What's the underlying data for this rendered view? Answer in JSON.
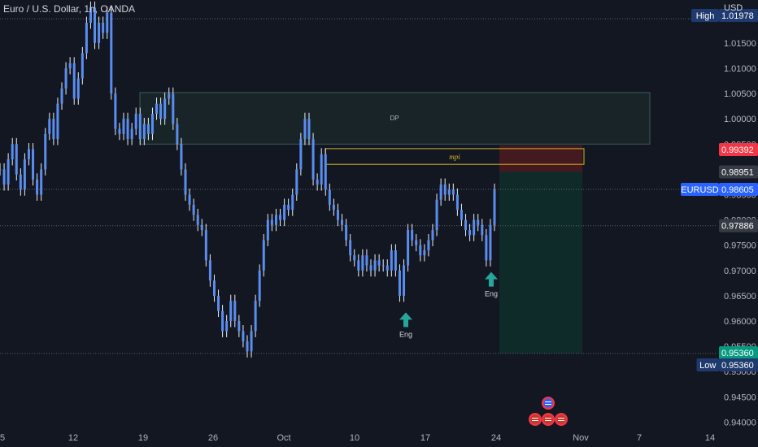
{
  "header": {
    "title": "Euro / U.S. Dollar, 1h, OANDA",
    "currency": "USD"
  },
  "colors": {
    "background": "#131722",
    "candle": "#5b8def",
    "candle_wick": "#e8eefc",
    "dp_zone_fill": "#1b2a2a",
    "mpi_box": "#d4b422",
    "stop_zone": "#4a1a1f",
    "target_zone": "#0f2e2a",
    "arrow": "#26a69a",
    "high_tag": "#1f3a6e",
    "current_tag": "#2962ff",
    "stop_tag": "#f23645",
    "neutral_tag": "#363a45",
    "low_target_tag": "#089981"
  },
  "chart_data": {
    "type": "line",
    "title": "Euro / U.S. Dollar, 1h, OANDA",
    "symbol": "EURUSD",
    "xlabel": "",
    "ylabel": "USD",
    "ylim": [
      0.9375,
      1.0235
    ],
    "grid": false,
    "x_ticks": [
      "5",
      "12",
      "19",
      "26",
      "Oct",
      "10",
      "17",
      "24",
      "Nov",
      "7",
      "14"
    ],
    "y_ticks": [
      "1.01500",
      "1.01000",
      "1.00500",
      "1.00000",
      "0.99500",
      "0.98500",
      "0.98000",
      "0.97500",
      "0.97000",
      "0.96500",
      "0.96000",
      "0.95500",
      "0.95000",
      "0.94500",
      "0.94000"
    ],
    "series": [
      {
        "values": [
          0.99,
          0.987,
          0.992,
          0.995,
          0.989,
          0.986,
          0.992,
          0.994,
          0.988,
          0.985,
          0.99,
          0.997,
          1.0,
          0.996,
          1.003,
          1.006,
          1.01,
          1.011,
          1.004,
          1.008,
          1.013,
          1.019,
          1.022,
          1.015,
          1.019,
          1.017,
          1.021,
          1.005,
          0.998,
          0.997,
          1.0,
          0.996,
          0.998,
          1.001,
          0.996,
          0.999,
          0.997,
          1.001,
          1.003,
          1.0,
          1.004,
          1.005,
          0.999,
          0.995,
          0.99,
          0.985,
          0.983,
          0.981,
          0.979,
          0.978,
          0.972,
          0.968,
          0.965,
          0.962,
          0.958,
          0.96,
          0.964,
          0.96,
          0.958,
          0.956,
          0.954,
          0.958,
          0.964,
          0.97,
          0.976,
          0.98,
          0.979,
          0.981,
          0.98,
          0.983,
          0.982,
          0.985,
          0.99,
          0.996,
          1.0,
          0.996,
          0.988,
          0.987,
          0.993,
          0.986,
          0.983,
          0.982,
          0.98,
          0.979,
          0.976,
          0.973,
          0.972,
          0.97,
          0.973,
          0.971,
          0.97,
          0.972,
          0.971,
          0.971,
          0.97,
          0.974,
          0.97,
          0.965,
          0.971,
          0.978,
          0.976,
          0.975,
          0.973,
          0.974,
          0.976,
          0.978,
          0.984,
          0.987,
          0.985,
          0.986,
          0.985,
          0.982,
          0.98,
          0.978,
          0.977,
          0.98,
          0.979,
          0.977,
          0.972,
          0.979,
          0.986
        ]
      }
    ],
    "zones": [
      {
        "label": "DP",
        "from": 0.995,
        "to": 1.0052
      },
      {
        "label": "mpi",
        "from": 0.991,
        "to": 0.9941
      }
    ],
    "position": {
      "entry": 0.98951,
      "stop": 0.99392,
      "target": 0.9536
    },
    "markers": [
      {
        "label": "Eng",
        "x": "15",
        "value": 0.963
      },
      {
        "label": "Eng",
        "x": "24",
        "value": 0.971
      }
    ],
    "price_tags": [
      {
        "label": "High",
        "value": "1.01978",
        "kind": "high"
      },
      {
        "label": "",
        "value": "0.99392",
        "kind": "stop"
      },
      {
        "label": "",
        "value": "0.98951",
        "kind": "neutral"
      },
      {
        "label": "EURUSD",
        "value": "0.98605",
        "kind": "current"
      },
      {
        "label": "",
        "value": "0.97886",
        "kind": "neutral"
      },
      {
        "label": "",
        "value": "0.95360",
        "kind": "target"
      },
      {
        "label": "Low",
        "value": "0.95360",
        "kind": "low"
      }
    ]
  }
}
